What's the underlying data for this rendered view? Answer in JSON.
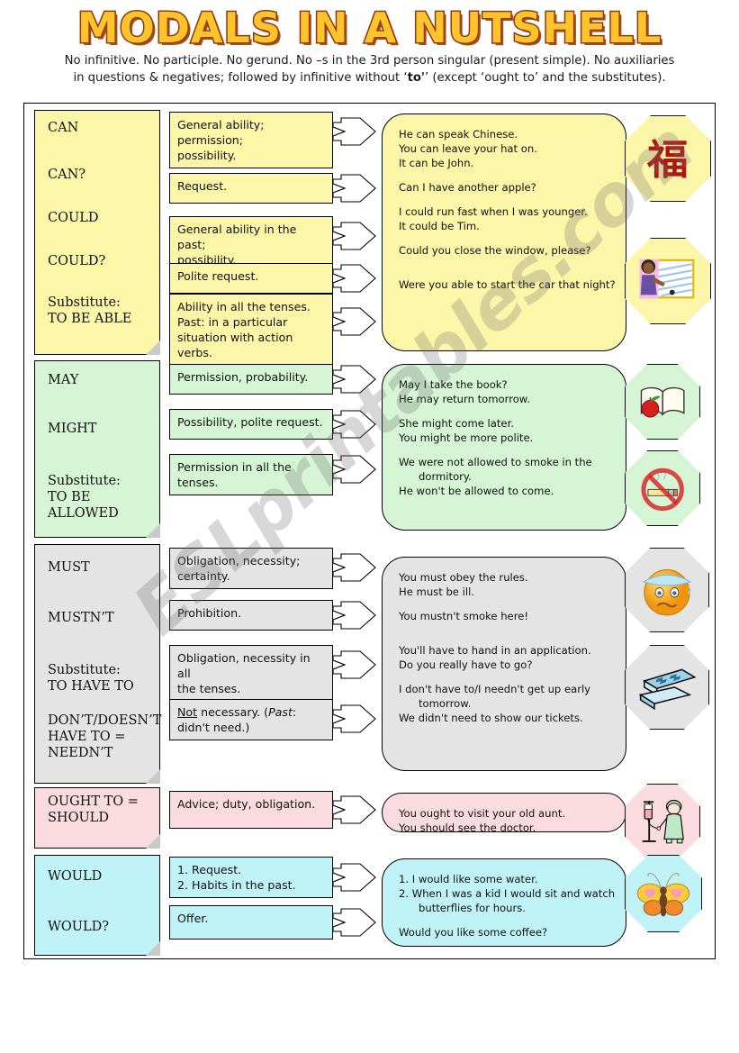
{
  "header": {
    "title": "MODALS IN A NUTSHELL",
    "subtitle_line1": "No infinitive. No participle. No gerund. No –s in the 3rd person singular (present simple). No auxiliaries",
    "subtitle_line2_a": "in questions & negatives; followed by infinitive without ‘",
    "subtitle_line2_b": "to'",
    "subtitle_line2_c": "’ (except ‘ought to’ and the substitutes)."
  },
  "watermark": "ESLprintables.com",
  "colors": {
    "title_fill": "#FFC32B",
    "title_outline": "#8C3A12",
    "yellow": "#FCF7A8",
    "green": "#D5F5D5",
    "gray": "#E4E4E4",
    "pink": "#FADCE0",
    "blue": "#BFF3F7"
  },
  "groups": [
    {
      "id": "can",
      "color_name": "yellow",
      "modals": [
        {
          "label": "CAN"
        },
        {
          "label": "CAN?"
        },
        {
          "label": "COULD"
        },
        {
          "label": "COULD?"
        },
        {
          "label": "Substitute:",
          "label2": "TO BE ABLE"
        }
      ],
      "usages": [
        {
          "lines": [
            "General ability;  permission;",
            "possibility."
          ]
        },
        {
          "lines": [
            "Request."
          ]
        },
        {
          "lines": [
            "General ability in the past;",
            "possibility."
          ]
        },
        {
          "lines": [
            "Polite request."
          ]
        },
        {
          "lines": [
            "Ability in all the tenses.",
            "Past:  in a particular",
            "situation with action verbs."
          ]
        }
      ],
      "examples": [
        {
          "text": "He can speak Chinese."
        },
        {
          "text": "You can leave your hat on."
        },
        {
          "text": "It can be John."
        },
        {
          "gap": true
        },
        {
          "text": "Can I have another apple?"
        },
        {
          "gap": true
        },
        {
          "text": "I could run fast when I was younger."
        },
        {
          "text": "It could be Tim."
        },
        {
          "gap": true
        },
        {
          "text": "Could you close the window, please?"
        },
        {
          "gap": true
        },
        {
          "gap": true
        },
        {
          "text": "Were you able to start the car that night?"
        }
      ],
      "badges": [
        {
          "icon": "chinese-character-fu-icon",
          "label": "福"
        },
        {
          "icon": "woman-at-window-icon",
          "label": "woman opening window"
        }
      ]
    },
    {
      "id": "may",
      "color_name": "green",
      "modals": [
        {
          "label": "MAY"
        },
        {
          "label": "MIGHT"
        },
        {
          "label": "Substitute:",
          "label2": "TO BE",
          "label3": "ALLOWED"
        }
      ],
      "usages": [
        {
          "lines": [
            "Permission, probability."
          ]
        },
        {
          "lines": [
            "Possibility, polite request."
          ]
        },
        {
          "lines": [
            "Permission in all the tenses."
          ]
        }
      ],
      "examples": [
        {
          "text": "May I take the book?"
        },
        {
          "text": "He may return tomorrow."
        },
        {
          "gap": true
        },
        {
          "text": "She might come later."
        },
        {
          "text": "You might be more polite."
        },
        {
          "gap": true
        },
        {
          "text": "We were not allowed to smoke in the"
        },
        {
          "text": "dormitory.",
          "indent": true
        },
        {
          "text": "He won't be allowed to come."
        }
      ],
      "badges": [
        {
          "icon": "book-and-apple-icon",
          "label": "open book with apple"
        },
        {
          "icon": "no-smoking-icon",
          "label": "no smoking sign"
        }
      ]
    },
    {
      "id": "must",
      "color_name": "gray",
      "modals": [
        {
          "label": "MUST"
        },
        {
          "label": "MUSTN’T"
        },
        {
          "label": "Substitute:",
          "label2": "TO HAVE TO"
        },
        {
          "label": "DON’T/DOESN’T",
          "label2": "HAVE TO =",
          "label3": "NEEDN’T"
        }
      ],
      "usages": [
        {
          "lines": [
            "Obligation, necessity;",
            "certainty."
          ]
        },
        {
          "lines": [
            "Prohibition."
          ]
        },
        {
          "lines": [
            "Obligation, necessity in all",
            "the tenses."
          ]
        },
        {
          "html": "<u>Not</u> necessary. (<i>Past</i>: didn't need.)"
        }
      ],
      "examples": [
        {
          "text": "You must obey the rules."
        },
        {
          "text": "He must be ill."
        },
        {
          "gap": true
        },
        {
          "text": "You mustn't smoke here!"
        },
        {
          "gap": true
        },
        {
          "gap": true
        },
        {
          "text": "You'll have to hand in an application."
        },
        {
          "text": "Do you really have to go?"
        },
        {
          "gap": true
        },
        {
          "text": "I don't have to/I needn't get up early"
        },
        {
          "text": "tomorrow.",
          "indent": true
        },
        {
          "text": "We didn't need to show our tickets."
        }
      ],
      "badges": [
        {
          "icon": "sick-face-icon",
          "label": "ill smiley with ice pack"
        },
        {
          "icon": "ticket-box-icon",
          "label": "open box of tickets"
        }
      ]
    },
    {
      "id": "ought",
      "color_name": "pink",
      "modals": [
        {
          "label": "OUGHT TO =",
          "label2": "SHOULD"
        }
      ],
      "usages": [
        {
          "lines": [
            "Advice; duty, obligation."
          ]
        }
      ],
      "examples": [
        {
          "text": "You ought to visit your old aunt."
        },
        {
          "text": "You should see the doctor."
        }
      ],
      "badges": [
        {
          "icon": "nurse-with-iv-drip-icon",
          "label": "nurse with IV drip"
        }
      ]
    },
    {
      "id": "would",
      "color_name": "blue",
      "modals": [
        {
          "label": "WOULD"
        },
        {
          "label": "WOULD?"
        }
      ],
      "usages": [
        {
          "lines": [
            "1. Request.",
            "2. Habits in the past."
          ]
        },
        {
          "lines": [
            "Offer."
          ]
        }
      ],
      "examples": [
        {
          "text": "1. I would like some water."
        },
        {
          "text": "2. When I was a kid I would sit and watch"
        },
        {
          "text": "butterflies for hours.",
          "indent": true
        },
        {
          "gap": true
        },
        {
          "text": "Would you like some coffee?"
        }
      ],
      "badges": [
        {
          "icon": "butterfly-icon",
          "label": "butterfly"
        }
      ]
    }
  ]
}
